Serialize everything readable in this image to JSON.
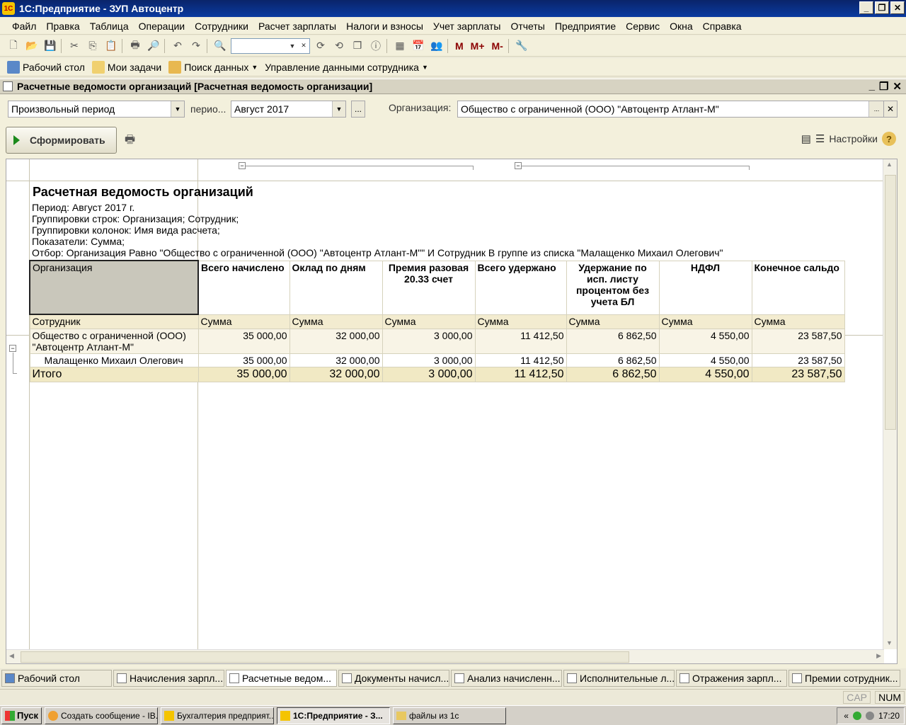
{
  "window": {
    "title": "1С:Предприятие - ЗУП Автоцентр",
    "logo": "1С"
  },
  "menu": [
    "Файл",
    "Правка",
    "Таблица",
    "Операции",
    "Сотрудники",
    "Расчет зарплаты",
    "Налоги и взносы",
    "Учет зарплаты",
    "Отчеты",
    "Предприятие",
    "Сервис",
    "Окна",
    "Справка"
  ],
  "toolbar": {
    "m": "M",
    "m_plus": "M+",
    "m_minus": "M-"
  },
  "panel": {
    "desktop": "Рабочий стол",
    "tasks": "Мои задачи",
    "search": "Поиск данных",
    "employee_data": "Управление данными сотрудника"
  },
  "doc": {
    "title": "Расчетные ведомости организаций [Расчетная ведомость организации]"
  },
  "form": {
    "period_type": "Произвольный период",
    "period_label": "перио...",
    "period_value": "Август 2017",
    "org_label": "Организация:",
    "org_value": "Общество с ограниченной (ООО) \"Автоцентр Атлант-М\"",
    "ellipsis": "...",
    "generate_btn": "Сформировать",
    "settings_label": "Настройки",
    "help": "?"
  },
  "report": {
    "title": "Расчетная ведомость организаций",
    "lines": [
      "Период: Август 2017 г.",
      "Группировки строк: Организация; Сотрудник;",
      "Группировки колонок: Имя вида расчета;",
      "Показатели: Сумма;",
      "Отбор: Организация Равно \"Общество с ограниченной (ООО) \"Автоцентр Атлант-М\"\" И Сотрудник В группе из списка \"Малащенко Михаил Олегович\""
    ],
    "header": {
      "org": "Организация",
      "cols": [
        "Всего начислено",
        "Оклад по дням",
        "Премия разовая 20.33 счет",
        "Всего удержано",
        "Удержание по исп. листу процентом без учета БЛ",
        "НДФЛ",
        "Конечное сальдо"
      ]
    },
    "subheader": {
      "row": "Сотрудник",
      "measure": "Сумма"
    },
    "org_row": {
      "name": "Общество с ограниченной (ООО) \"Автоцентр Атлант-М\"",
      "values": [
        "35 000,00",
        "32 000,00",
        "3 000,00",
        "11 412,50",
        "6 862,50",
        "4 550,00",
        "23 587,50"
      ]
    },
    "emp_row": {
      "name": "Малащенко Михаил Олегович",
      "values": [
        "35 000,00",
        "32 000,00",
        "3 000,00",
        "11 412,50",
        "6 862,50",
        "4 550,00",
        "23 587,50"
      ]
    },
    "total_row": {
      "name": "Итого",
      "values": [
        "35 000,00",
        "32 000,00",
        "3 000,00",
        "11 412,50",
        "6 862,50",
        "4 550,00",
        "23 587,50"
      ]
    }
  },
  "open_windows": [
    "Рабочий стол",
    "Начисления зарпл...",
    "Расчетные ведом...",
    "Документы начисл...",
    "Анализ начисленн...",
    "Исполнительные л...",
    "Отражения зарпл...",
    "Премии сотрудник..."
  ],
  "status": {
    "cap": "CAP",
    "num": "NUM"
  },
  "taskbar": {
    "start": "Пуск",
    "items": [
      "Создать сообщение - IB...",
      "Бухгалтерия предприят...",
      "1С:Предприятие - З...",
      "файлы из 1с"
    ],
    "tray_arrows": "«",
    "clock": "17:20"
  }
}
